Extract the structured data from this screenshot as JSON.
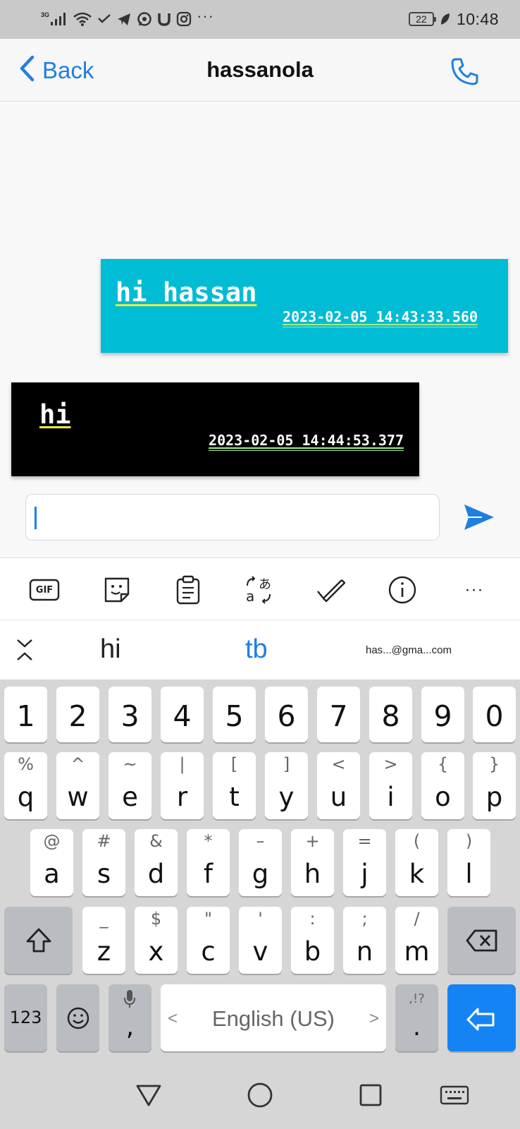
{
  "status_bar": {
    "network_label": "3G",
    "battery": "22",
    "time": "10:48",
    "overflow": "···",
    "icons": [
      "signal-icon",
      "wifi-icon",
      "check-arrow-icon",
      "telegram-icon",
      "whatsapp-icon",
      "u-icon",
      "instagram-icon",
      "leaf-icon"
    ]
  },
  "header": {
    "back_label": "Back",
    "title": "hassanola",
    "accent": "#1f7fe0"
  },
  "messages": [
    {
      "direction": "sent",
      "text": "hi hassan",
      "timestamp": "2023-02-05 14:43:33.560",
      "background": "#00bcd4"
    },
    {
      "direction": "received",
      "text": "hi",
      "timestamp": "2023-02-05 14:44:53.377",
      "background": "#000000"
    }
  ],
  "composer": {
    "value": "",
    "placeholder": ""
  },
  "keyboard": {
    "toolbar": {
      "gif_label": "GIF",
      "more_label": "···",
      "icons": [
        "gif-icon",
        "sticker-icon",
        "clipboard-icon",
        "translate-icon",
        "handwriting-icon",
        "info-icon",
        "more-icon"
      ]
    },
    "suggestions": [
      "hi",
      "tb",
      "has...@gma...com"
    ],
    "number_row": [
      "1",
      "2",
      "3",
      "4",
      "5",
      "6",
      "7",
      "8",
      "9",
      "0"
    ],
    "row1": [
      {
        "main": "q",
        "sub": "%"
      },
      {
        "main": "w",
        "sub": "^"
      },
      {
        "main": "e",
        "sub": "~"
      },
      {
        "main": "r",
        "sub": "|"
      },
      {
        "main": "t",
        "sub": "["
      },
      {
        "main": "y",
        "sub": "]"
      },
      {
        "main": "u",
        "sub": "<"
      },
      {
        "main": "i",
        "sub": ">"
      },
      {
        "main": "o",
        "sub": "{"
      },
      {
        "main": "p",
        "sub": "}"
      }
    ],
    "row2": [
      {
        "main": "a",
        "sub": "@"
      },
      {
        "main": "s",
        "sub": "#"
      },
      {
        "main": "d",
        "sub": "&"
      },
      {
        "main": "f",
        "sub": "*"
      },
      {
        "main": "g",
        "sub": "–"
      },
      {
        "main": "h",
        "sub": "+"
      },
      {
        "main": "j",
        "sub": "="
      },
      {
        "main": "k",
        "sub": "("
      },
      {
        "main": "l",
        "sub": ")"
      }
    ],
    "row3": [
      {
        "main": "z",
        "sub": "_"
      },
      {
        "main": "x",
        "sub": "$"
      },
      {
        "main": "c",
        "sub": "\""
      },
      {
        "main": "v",
        "sub": "'"
      },
      {
        "main": "b",
        "sub": ":"
      },
      {
        "main": "n",
        "sub": ";"
      },
      {
        "main": "m",
        "sub": "/"
      }
    ],
    "bottom": {
      "numbers_label": "123",
      "comma_label": ",",
      "space_label": "English (US)",
      "space_left": "<",
      "space_right": ">",
      "period_label": ".",
      "period_sub": ",!?"
    }
  }
}
